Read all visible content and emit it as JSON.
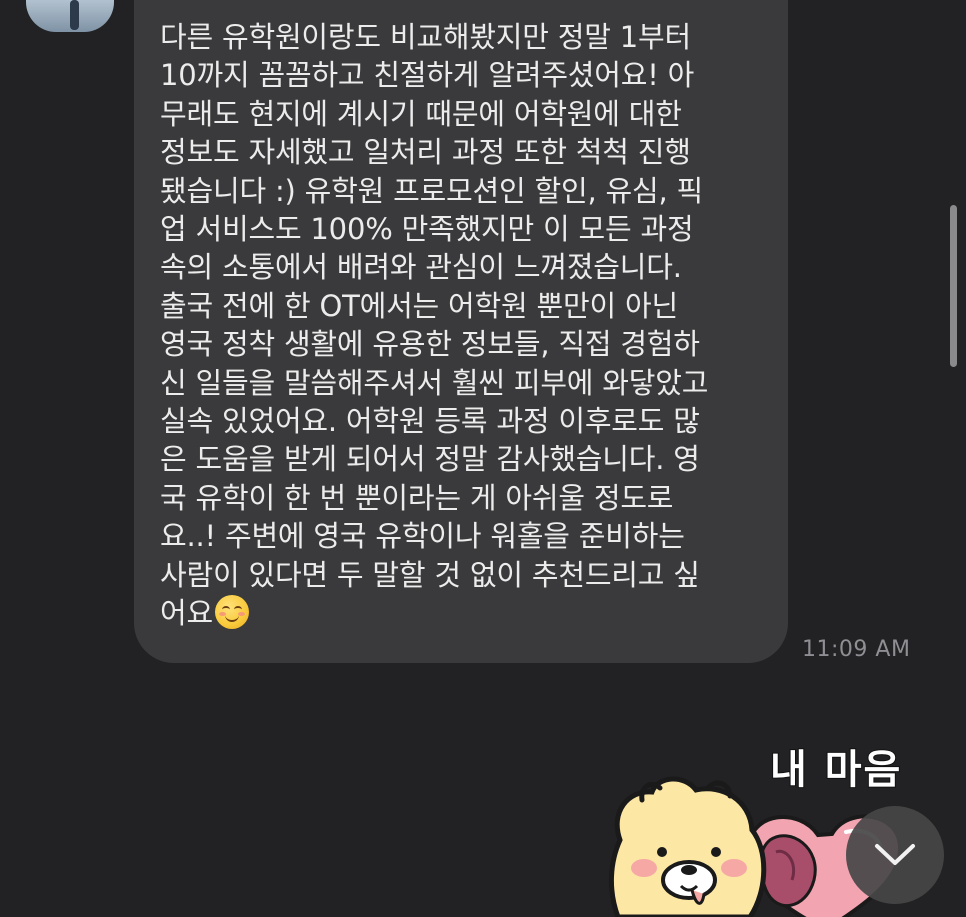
{
  "message": {
    "lines": [
      "다른 유학원이랑도 비교해봤지만 정말 1부터",
      "10까지 꼼꼼하고 친절하게 알려주셨어요! 아",
      "무래도 현지에 계시기 때문에 어학원에 대한",
      "정보도 자세했고 일처리 과정 또한 척척 진행",
      "됐습니다 :) 유학원 프로모션인 할인, 유심, 픽",
      "업 서비스도 100% 만족했지만 이 모든 과정",
      "속의 소통에서 배려와 관심이 느껴졌습니다.",
      "출국 전에 한 OT에서는 어학원 뿐만이 아닌",
      "영국 정착 생활에 유용한 정보들, 직접 경험하",
      "신 일들을 말씀해주셔서 훨씬 피부에 와닿았고",
      "실속 있었어요. 어학원 등록 과정 이후로도 많",
      "은 도움을 받게 되어서 정말 감사했습니다. 영",
      "국 유학이 한 번 뿐이라는 게 아쉬울 정도로",
      "요..! 주변에 영국 유학이나 워홀을 준비하는",
      "사람이 있다면 두 말할 것 없이 추천드리고 싶",
      "어요"
    ],
    "emoji": "smiling-face-emoji",
    "timestamp": "11:09 AM"
  },
  "sticker": {
    "caption": "내 마음",
    "character": "yellow-bear-character",
    "heart_color": "#f2a5b0",
    "sweet_potato_color": "#a84e6a"
  },
  "controls": {
    "scroll_down_icon": "chevron-down-icon"
  },
  "colors": {
    "background": "#222224",
    "bubble": "#3a3a3c",
    "text": "#ececec",
    "timestamp": "#8e8e93"
  }
}
